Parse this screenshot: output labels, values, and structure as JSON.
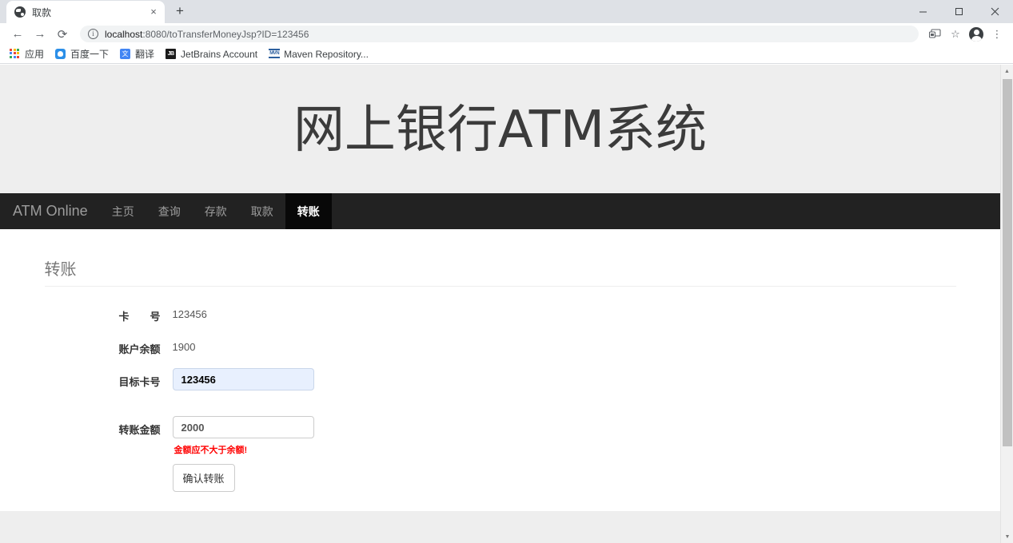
{
  "browser": {
    "tab": {
      "title": "取款",
      "favicon": "globe-icon",
      "close": "×"
    },
    "new_tab": "+",
    "window_controls": {
      "minimize": "—",
      "maximize": "❐",
      "close": "✕"
    },
    "nav": {
      "back": "←",
      "forward": "→",
      "reload": "⟳"
    },
    "omnibox": {
      "info_icon": "ⓘ",
      "host": "localhost",
      "path": ":8080/toTransferMoneyJsp?ID=123456",
      "full_url": "localhost:8080/toTransferMoneyJsp?ID=123456"
    },
    "toolbar_icons": {
      "cast": "cast-icon",
      "bookmark_star": "☆",
      "profile": "avatar-icon",
      "menu": "⋮"
    },
    "bookmarks": [
      {
        "label": "应用",
        "icon": "apps-grid-icon"
      },
      {
        "label": "百度一下",
        "icon": "baidu-icon"
      },
      {
        "label": "翻译",
        "icon": "translate-icon"
      },
      {
        "label": "JetBrains Account",
        "icon": "jetbrains-icon"
      },
      {
        "label": "Maven Repository...",
        "icon": "maven-icon"
      }
    ],
    "scrollbar": {
      "up": "▲",
      "down": "▼"
    }
  },
  "page": {
    "hero_title": "网上银行ATM系统",
    "navbar": {
      "brand": "ATM Online",
      "items": [
        {
          "label": "主页",
          "active": false
        },
        {
          "label": "查询",
          "active": false
        },
        {
          "label": "存款",
          "active": false
        },
        {
          "label": "取款",
          "active": false
        },
        {
          "label": "转账",
          "active": true
        }
      ]
    },
    "heading": "转账",
    "form": {
      "card_no_label": "卡　　号",
      "card_no_value": "123456",
      "balance_label": "账户余额",
      "balance_value": "1900",
      "target_card_label": "目标卡号",
      "target_card_value": "123456",
      "amount_label": "转账金额",
      "amount_value": "2000",
      "error_message": "金额应不大于余额!",
      "submit_label": "确认转账"
    },
    "colors": {
      "hero_bg": "#eeeeee",
      "navbar_bg": "#222222",
      "navbar_active_bg": "#080808",
      "navbar_link": "#9d9d9d",
      "heading": "#777777",
      "error": "#ff0000",
      "autofill_bg": "#e8f0fe"
    }
  }
}
